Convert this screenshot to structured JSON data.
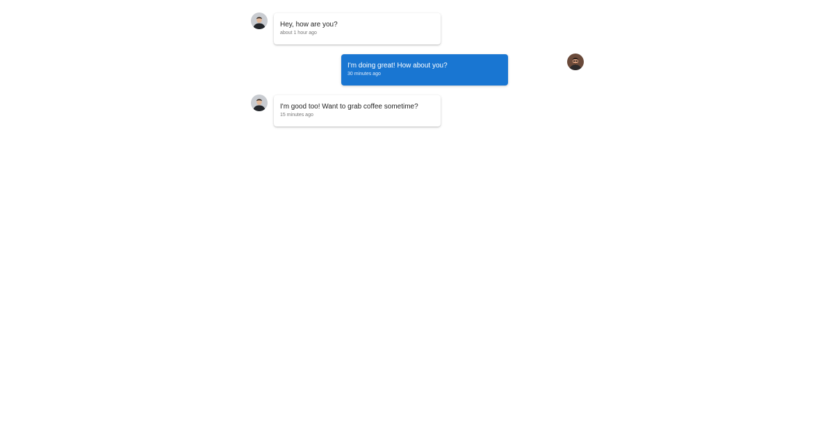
{
  "messages": [
    {
      "sender": "contact",
      "avatar_icon": "contact-avatar-icon",
      "text": "Hey, how are you?",
      "time": "about 1 hour ago"
    },
    {
      "sender": "self",
      "avatar_icon": "user-avatar-icon",
      "text": "I'm doing great! How about you?",
      "time": "30 minutes ago"
    },
    {
      "sender": "contact",
      "avatar_icon": "contact-avatar-icon",
      "text": "I'm good too! Want to grab coffee sometime?",
      "time": "15 minutes ago"
    }
  ],
  "colors": {
    "outgoing_bubble": "#1976d2",
    "incoming_bubble": "#ffffff",
    "page_background": "#ffffff"
  }
}
